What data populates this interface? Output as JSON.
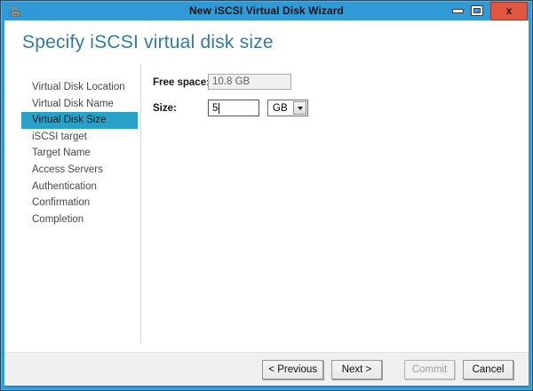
{
  "window": {
    "title": "New iSCSI Virtual Disk Wizard",
    "close_glyph": "x"
  },
  "page": {
    "heading": "Specify iSCSI virtual disk size"
  },
  "sidebar": {
    "items": [
      {
        "label": "Virtual Disk Location",
        "selected": false
      },
      {
        "label": "Virtual Disk Name",
        "selected": false
      },
      {
        "label": "Virtual Disk Size",
        "selected": true
      },
      {
        "label": "iSCSI target",
        "selected": false
      },
      {
        "label": "Target Name",
        "selected": false
      },
      {
        "label": "Access Servers",
        "selected": false
      },
      {
        "label": "Authentication",
        "selected": false
      },
      {
        "label": "Confirmation",
        "selected": false
      },
      {
        "label": "Completion",
        "selected": false
      }
    ]
  },
  "form": {
    "free_space": {
      "label": "Free space:",
      "value": "10.8 GB",
      "disabled": true
    },
    "size": {
      "label": "Size:",
      "value": "5"
    },
    "unit": {
      "value": "GB"
    }
  },
  "footer": {
    "buttons": [
      {
        "label": "< Previous",
        "enabled": true
      },
      {
        "label": "Next >",
        "enabled": true
      },
      {
        "label": "Commit",
        "enabled": false
      },
      {
        "label": "Cancel",
        "enabled": true
      }
    ]
  },
  "colors": {
    "frame_blue": "#2f9ad6",
    "heading_text": "#2d7da5",
    "nav_selected_bg": "#29a2c9",
    "close_button_bg": "#e0563f",
    "footer_bg": "#f0f0f0"
  }
}
